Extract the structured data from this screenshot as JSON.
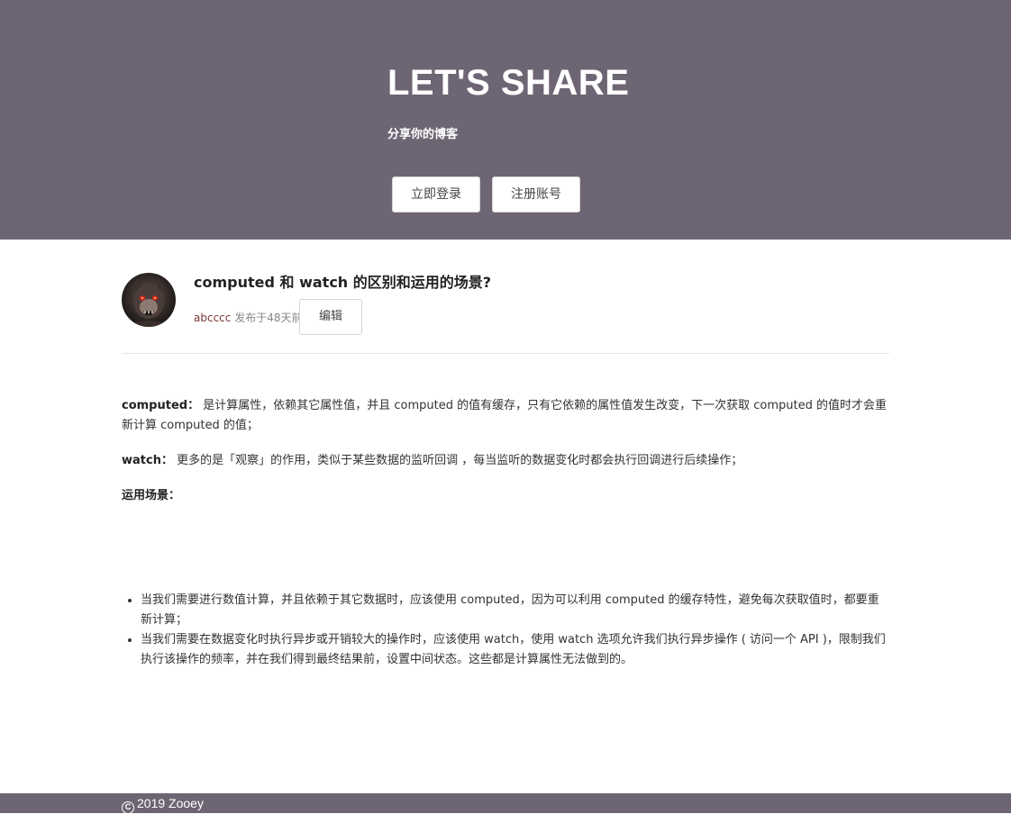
{
  "hero": {
    "title": "LET'S SHARE",
    "subtitle": "分享你的博客",
    "login_label": "立即登录",
    "register_label": "注册账号"
  },
  "post": {
    "title": "computed 和 watch 的区别和运用的场景?",
    "author": "abcccc",
    "published": " 发布于48天前",
    "edit_label": "编辑",
    "avatar_icon": "avatar-image"
  },
  "article": {
    "computed_label": "computed：",
    "computed_text": " 是计算属性，依赖其它属性值，并且 computed 的值有缓存，只有它依赖的属性值发生改变，下一次获取 computed 的值时才会重新计算 computed 的值；",
    "watch_label": "watch：",
    "watch_text": " 更多的是「观察」的作用，类似于某些数据的监听回调 ，每当监听的数据变化时都会执行回调进行后续操作；",
    "scenes_label": "运用场景：",
    "scenes": [
      "当我们需要进行数值计算，并且依赖于其它数据时，应该使用 computed，因为可以利用 computed 的缓存特性，避免每次获取值时，都要重新计算；",
      "当我们需要在数据变化时执行异步或开销较大的操作时，应该使用 watch，使用 watch 选项允许我们执行异步操作 ( 访问一个 API )，限制我们执行该操作的频率，并在我们得到最终结果前，设置中间状态。这些都是计算属性无法做到的。"
    ]
  },
  "footer": {
    "copyright_symbol": "C",
    "text": "2019 Zooey"
  },
  "colors": {
    "header_bg": "#6e6574",
    "footer_bg": "#6e6574",
    "author": "#7a3b38"
  }
}
